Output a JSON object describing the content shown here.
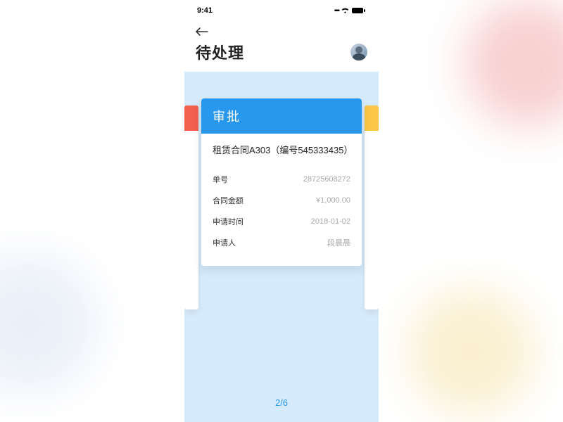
{
  "status": {
    "time": "9:41"
  },
  "header": {
    "title": "待处理"
  },
  "card": {
    "type_label": "审批",
    "title": "租赁合同A303（编号545333435）",
    "fields": [
      {
        "label": "单号",
        "value": "28725608272"
      },
      {
        "label": "合同金额",
        "value": "¥1,000.00"
      },
      {
        "label": "申请时间",
        "value": "2018-01-02"
      },
      {
        "label": "申请人",
        "value": "段晨晨"
      }
    ]
  },
  "pager": {
    "text": "2/6",
    "current": 2,
    "total": 6
  },
  "colors": {
    "primary": "#2897ee",
    "prev_accent": "#f25f4c",
    "next_accent": "#f9c646",
    "content_bg": "#d6ebfb"
  }
}
